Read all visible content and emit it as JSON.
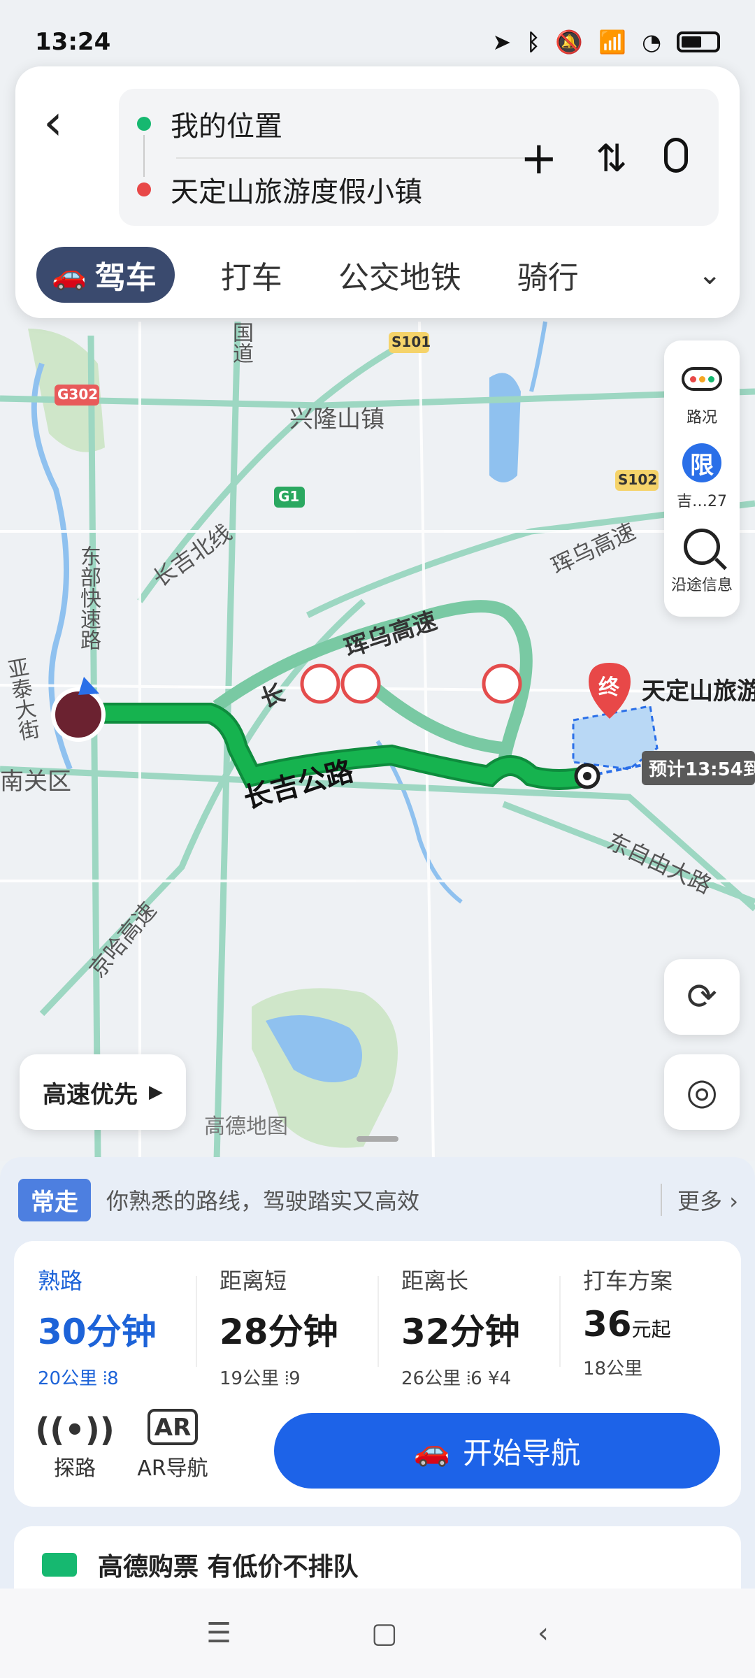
{
  "status_bar": {
    "time": "13:24"
  },
  "top_card": {
    "from": "我的位置",
    "to": "天定山旅游度假小镇",
    "tabs": [
      "驾车",
      "打车",
      "公交地铁",
      "骑行"
    ]
  },
  "map": {
    "labels": {
      "xinglong": "兴隆山镇",
      "s101": "S101",
      "g302": "G302",
      "g1": "G1",
      "s102": "S102",
      "changji_north": "长吉北线",
      "hunwu_top": "珲乌高速",
      "hunwu_mid": "珲乌高速",
      "changji_road": "长吉公路",
      "dongzi": "东自由大路",
      "jingha": "京哈高速",
      "dongbu": "东部快速路",
      "yatai": "亚泰大街",
      "nanguan": "南关区",
      "guodao": "国道",
      "amap": "高德地图",
      "chang": "长"
    },
    "destination": {
      "name": "天定山旅游度假小镇",
      "end_tag": "终",
      "eta": "预计13:54到"
    },
    "route_color": "#16b34f"
  },
  "side_panel": {
    "traffic": "路况",
    "limit_icon": "限",
    "limit_label": "吉…27",
    "search": "沿途信息"
  },
  "highway_pref": "高速优先",
  "sheet": {
    "familiar_tag": "常走",
    "familiar_text": "你熟悉的路线，驾驶踏实又高效",
    "more": "更多",
    "options": [
      {
        "name": "熟路",
        "time": "30分钟",
        "meta": "20公里 ⦙8"
      },
      {
        "name": "距离短",
        "time": "28分钟",
        "meta": "19公里 ⦙9"
      },
      {
        "name": "距离长",
        "time": "32分钟",
        "meta": "26公里 ⦙6 ¥4"
      },
      {
        "name": "打车方案",
        "time": "36",
        "time_unit": "元起",
        "meta": "18公里"
      }
    ],
    "explore": "探路",
    "ar": "AR导航",
    "ar_icon": "AR",
    "start_nav": "开始导航"
  },
  "ticket": "高德购票 有低价不排队"
}
